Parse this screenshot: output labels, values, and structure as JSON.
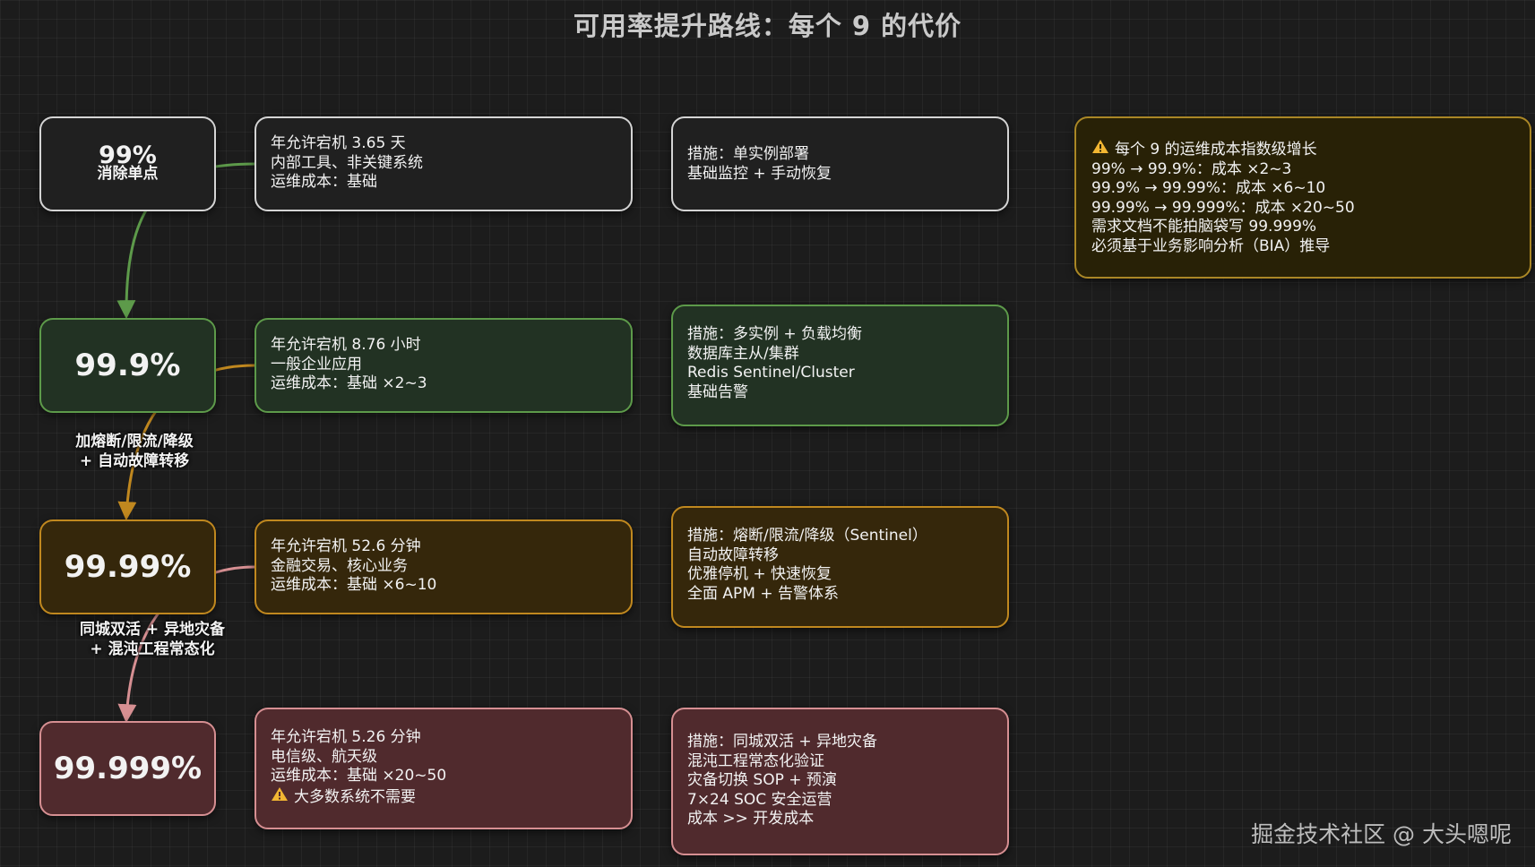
{
  "title": "可用率提升路线：每个 9 的代价",
  "levels": [
    {
      "value": "99%",
      "sublabel": "消除单点",
      "info": "年允许宕机 3.65 天\n内部工具、非关键系统\n运维成本：基础",
      "measures": "措施：单实例部署\n基础监控 + 手动恢复"
    },
    {
      "value": "99.9%",
      "info": "年允许宕机 8.76 小时\n一般企业应用\n运维成本：基础 ×2~3",
      "measures": "措施：多实例 + 负载均衡\n数据库主从/集群\nRedis Sentinel/Cluster\n基础告警"
    },
    {
      "value": "99.99%",
      "info": "年允许宕机 52.6 分钟\n金融交易、核心业务\n运维成本：基础 ×6~10",
      "measures": "措施：熔断/限流/降级（Sentinel）\n自动故障转移\n优雅停机 + 快速恢复\n全面 APM + 告警体系"
    },
    {
      "value": "99.999%",
      "info": "年允许宕机 5.26 分钟\n电信级、航天级\n运维成本：基础 ×20~50",
      "info_warning": "大多数系统不需要",
      "measures": "措施：同城双活 + 异地灾备\n混沌工程常态化验证\n灾备切换 SOP + 预演\n7×24 SOC 安全运营\n成本 >> 开发成本"
    }
  ],
  "transitions": [
    {
      "label": "加熔断/限流/降级\n+ 自动故障转移"
    },
    {
      "label": "同城双活 + 异地灾备\n+ 混沌工程常态化"
    }
  ],
  "warning_box": {
    "heading": "每个 9 的运维成本指数级增长",
    "lines": "99% → 99.9%：成本 ×2~3\n99.9% → 99.99%：成本 ×6~10\n99.99% → 99.999%：成本 ×20~50\n需求文档不能拍脑袋写 99.999%\n必须基于业务影响分析（BIA）推导"
  },
  "colors": {
    "green": "#5d9a4a",
    "amber": "#c0881f",
    "red": "#d68f92",
    "warning": "#f2b632"
  },
  "watermark": "掘金技术社区 @ 大头嗯呢"
}
